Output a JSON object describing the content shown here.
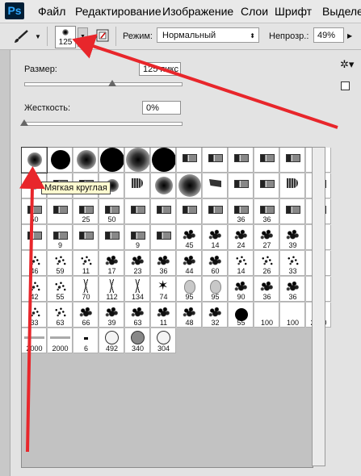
{
  "menubar": {
    "logo": "Ps",
    "items": [
      "Файл",
      "Редактирование",
      "Изображение",
      "Слои",
      "Шрифт",
      "Выделе"
    ]
  },
  "options_bar": {
    "preset_size": "125",
    "mode_label": "Режим:",
    "mode_value": "Нормальный",
    "opacity_label": "Непрозр.:",
    "opacity_value": "49%"
  },
  "brush_panel": {
    "size_label": "Размер:",
    "size_value": "125 пикс",
    "size_slider_percent": 56,
    "hardness_label": "Жесткость:",
    "hardness_value": "0%",
    "hardness_slider_percent": 0,
    "tooltip": "Мягкая круглая",
    "presets": [
      {
        "l": "",
        "k": "soft",
        "s": 9,
        "sel": true
      },
      {
        "l": "",
        "k": "hard",
        "s": 12
      },
      {
        "l": "",
        "k": "soft",
        "s": 12
      },
      {
        "l": "",
        "k": "hard",
        "s": 15
      },
      {
        "l": "",
        "k": "soft",
        "s": 15
      },
      {
        "l": "",
        "k": "hard",
        "s": 15
      },
      {
        "l": "",
        "k": "pen"
      },
      {
        "l": "",
        "k": "marker"
      },
      {
        "l": "",
        "k": "marker"
      },
      {
        "l": "",
        "k": "marker"
      },
      {
        "l": "",
        "k": "pen"
      },
      {
        "l": "",
        "k": "fan"
      },
      {
        "l": "",
        "k": "soft",
        "s": 5
      },
      {
        "l": "",
        "k": "pen"
      },
      {
        "l": "",
        "k": "pen"
      },
      {
        "l": "",
        "k": "soft",
        "s": 8
      },
      {
        "l": "",
        "k": "fan"
      },
      {
        "l": "",
        "k": "soft",
        "s": 11
      },
      {
        "l": "",
        "k": "soft",
        "s": 14
      },
      {
        "l": "",
        "k": "wedge"
      },
      {
        "l": "",
        "k": "marker"
      },
      {
        "l": "",
        "k": "marker"
      },
      {
        "l": "",
        "k": "fan"
      },
      {
        "l": "25",
        "k": "marker"
      },
      {
        "l": "50",
        "k": "marker"
      },
      {
        "l": "",
        "k": "pen"
      },
      {
        "l": "25",
        "k": "marker"
      },
      {
        "l": "50",
        "k": "marker"
      },
      {
        "l": "",
        "k": "pen"
      },
      {
        "l": "",
        "k": "pen"
      },
      {
        "l": "",
        "k": "pen"
      },
      {
        "l": "",
        "k": "pen"
      },
      {
        "l": "36",
        "k": "marker"
      },
      {
        "l": "36",
        "k": "marker"
      },
      {
        "l": "",
        "k": "marker"
      },
      {
        "l": "36",
        "k": "marker"
      },
      {
        "l": "",
        "k": "marker"
      },
      {
        "l": "9",
        "k": "pen"
      },
      {
        "l": "",
        "k": "pen"
      },
      {
        "l": "",
        "k": "pen"
      },
      {
        "l": "9",
        "k": "pen"
      },
      {
        "l": "",
        "k": "pen"
      },
      {
        "l": "45",
        "k": "splat"
      },
      {
        "l": "14",
        "k": "splat"
      },
      {
        "l": "24",
        "k": "splat"
      },
      {
        "l": "27",
        "k": "splat"
      },
      {
        "l": "39",
        "k": "splat"
      },
      {
        "l": "",
        "k": "empty"
      },
      {
        "l": "46",
        "k": "spray"
      },
      {
        "l": "59",
        "k": "spray"
      },
      {
        "l": "11",
        "k": "spray"
      },
      {
        "l": "17",
        "k": "splat"
      },
      {
        "l": "23",
        "k": "splat"
      },
      {
        "l": "36",
        "k": "splat"
      },
      {
        "l": "44",
        "k": "splat"
      },
      {
        "l": "60",
        "k": "splat"
      },
      {
        "l": "14",
        "k": "spray"
      },
      {
        "l": "26",
        "k": "spray"
      },
      {
        "l": "33",
        "k": "spray"
      },
      {
        "l": "",
        "k": "empty"
      },
      {
        "l": "42",
        "k": "spray"
      },
      {
        "l": "55",
        "k": "spray"
      },
      {
        "l": "70",
        "k": "grass"
      },
      {
        "l": "112",
        "k": "grass"
      },
      {
        "l": "134",
        "k": "grass"
      },
      {
        "l": "74",
        "k": "leaf"
      },
      {
        "l": "95",
        "k": "blob"
      },
      {
        "l": "95",
        "k": "blob"
      },
      {
        "l": "90",
        "k": "splat"
      },
      {
        "l": "36",
        "k": "splat"
      },
      {
        "l": "36",
        "k": "splat"
      },
      {
        "l": "",
        "k": "empty"
      },
      {
        "l": "33",
        "k": "spray"
      },
      {
        "l": "63",
        "k": "spray"
      },
      {
        "l": "66",
        "k": "splat"
      },
      {
        "l": "39",
        "k": "splat"
      },
      {
        "l": "63",
        "k": "splat"
      },
      {
        "l": "11",
        "k": "splat"
      },
      {
        "l": "48",
        "k": "splat"
      },
      {
        "l": "32",
        "k": "splat"
      },
      {
        "l": "55",
        "k": "hard",
        "s": 8
      },
      {
        "l": "100",
        "k": "empty"
      },
      {
        "l": "100",
        "k": "empty"
      },
      {
        "l": "2000",
        "k": "splat"
      },
      {
        "l": "2000",
        "k": "line"
      },
      {
        "l": "2000",
        "k": "line"
      },
      {
        "l": "6",
        "k": "dash"
      },
      {
        "l": "492",
        "k": "ring"
      },
      {
        "l": "340",
        "k": "ringfill"
      },
      {
        "l": "304",
        "k": "ring"
      }
    ]
  }
}
